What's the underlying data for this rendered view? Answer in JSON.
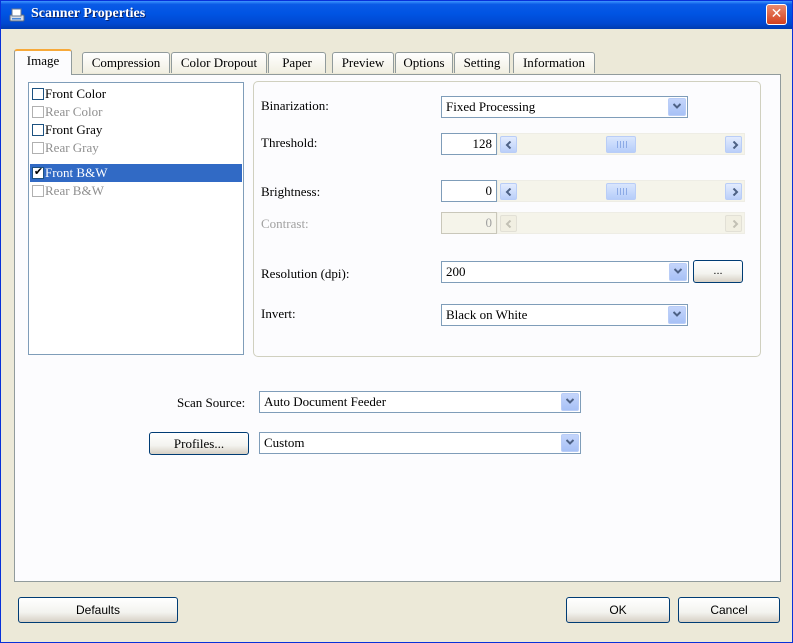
{
  "window": {
    "title": "Scanner Properties",
    "close_glyph": "✕"
  },
  "tabs": [
    {
      "label": "Image",
      "active": true
    },
    {
      "label": "Compression"
    },
    {
      "label": "Color Dropout"
    },
    {
      "label": "Paper"
    },
    {
      "label": "Preview"
    },
    {
      "label": "Options"
    },
    {
      "label": "Setting"
    },
    {
      "label": "Information"
    }
  ],
  "image_types": [
    {
      "label": "Front Color",
      "checked": false,
      "enabled": true,
      "selected": false
    },
    {
      "label": "Rear Color",
      "checked": false,
      "enabled": false,
      "selected": false
    },
    {
      "label": "Front Gray",
      "checked": false,
      "enabled": true,
      "selected": false
    },
    {
      "label": "Rear Gray",
      "checked": false,
      "enabled": false,
      "selected": false
    },
    {
      "label": "Front B&W",
      "checked": true,
      "enabled": true,
      "selected": true
    },
    {
      "label": "Rear B&W",
      "checked": false,
      "enabled": false,
      "selected": false
    }
  ],
  "check_glyph": "✔",
  "settings": {
    "binarization": {
      "label": "Binarization:",
      "value": "Fixed Processing"
    },
    "threshold": {
      "label": "Threshold:",
      "value": "128",
      "level": 0.5
    },
    "brightness": {
      "label": "Brightness:",
      "value": "0",
      "level": 0.5
    },
    "contrast": {
      "label": "Contrast:",
      "value": "0",
      "enabled": false
    },
    "resolution": {
      "label": "Resolution (dpi):",
      "value": "200",
      "more_label": "..."
    },
    "invert": {
      "label": "Invert:",
      "value": "Black on White"
    }
  },
  "scan_source": {
    "label": "Scan Source:",
    "value": "Auto Document Feeder"
  },
  "profiles": {
    "button_label": "Profiles...",
    "value": "Custom"
  },
  "footer": {
    "defaults_label": "Defaults",
    "ok_label": "OK",
    "cancel_label": "Cancel"
  },
  "icons": {
    "title": "scanner-icon",
    "dropdown": "chevron-down-icon",
    "scroll_left": "arrow-left-icon",
    "scroll_right": "arrow-right-icon",
    "close": "close-icon"
  },
  "colors": {
    "titlebar": "#0054e3",
    "selection": "#316ac5",
    "active_tab_accent": "#f7a93a",
    "dialog_bg": "#ece9d8"
  }
}
